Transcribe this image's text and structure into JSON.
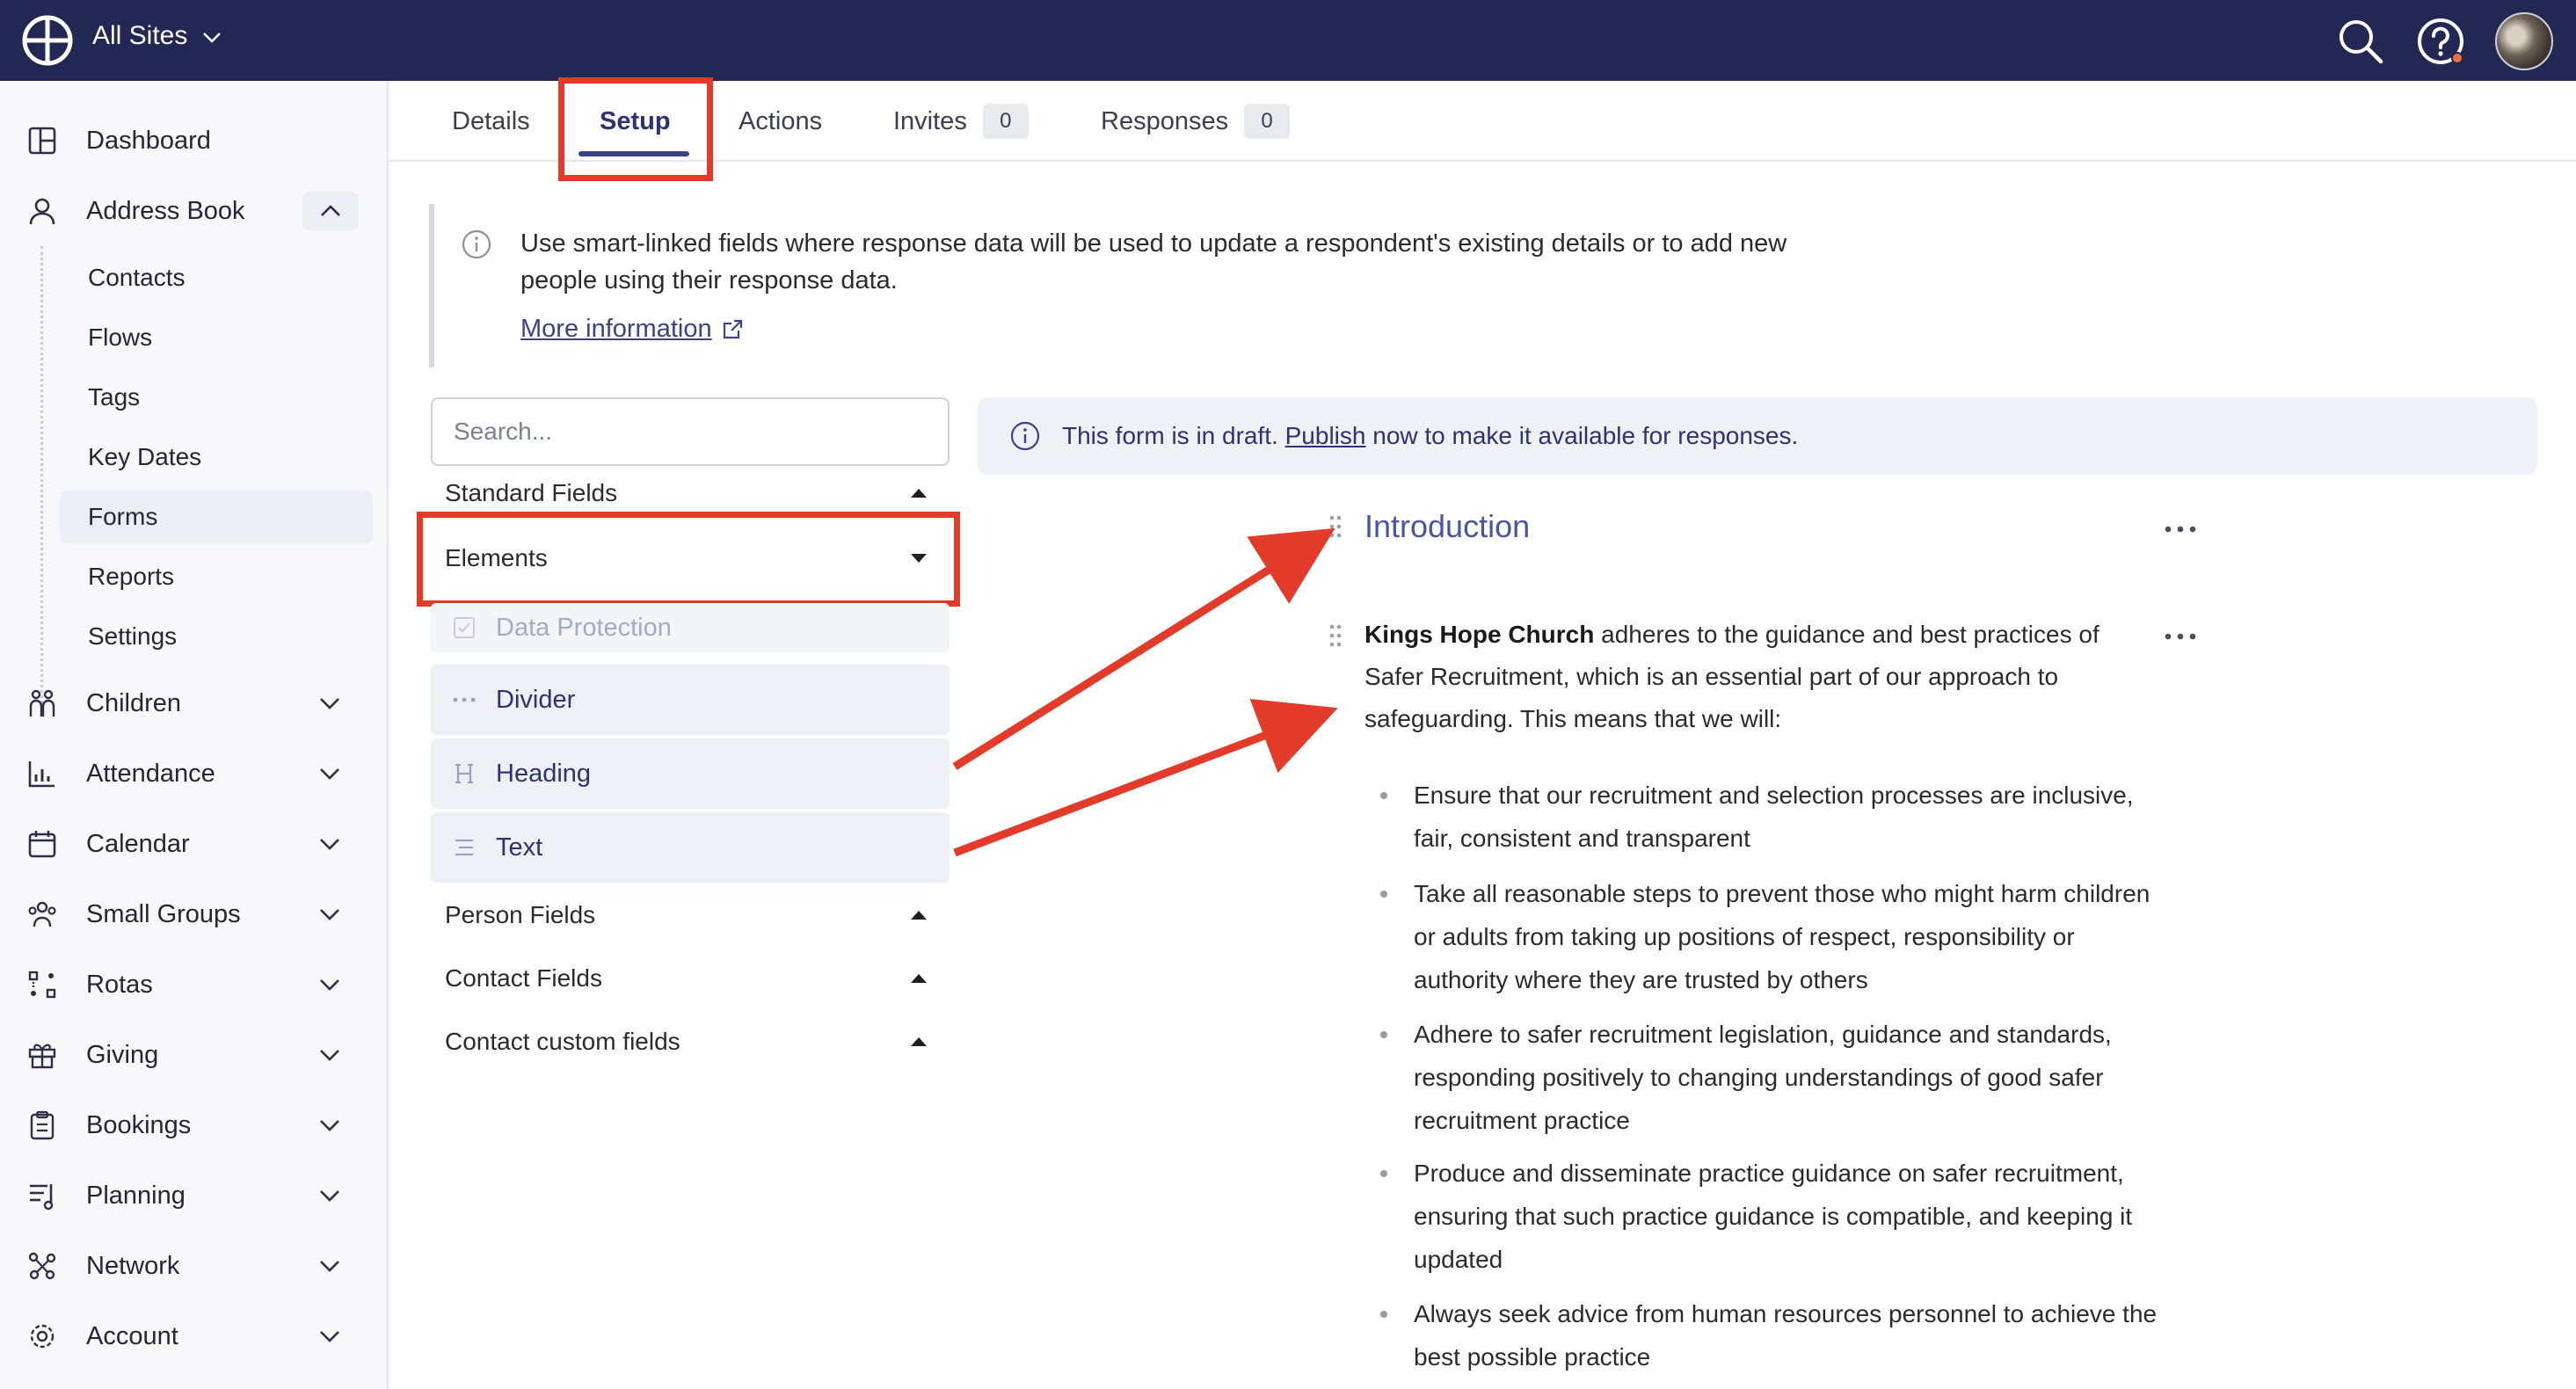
{
  "topbar": {
    "site_selector": "All Sites",
    "search_icon": "search-icon",
    "help_icon": "help-icon"
  },
  "sidebar": {
    "items": [
      {
        "label": "Dashboard",
        "icon": "dashboard-icon"
      },
      {
        "label": "Address Book",
        "icon": "person-icon"
      },
      {
        "label": "Children",
        "icon": "children-icon"
      },
      {
        "label": "Attendance",
        "icon": "chart-icon"
      },
      {
        "label": "Calendar",
        "icon": "calendar-icon"
      },
      {
        "label": "Small Groups",
        "icon": "groups-icon"
      },
      {
        "label": "Rotas",
        "icon": "rotas-icon"
      },
      {
        "label": "Giving",
        "icon": "gift-icon"
      },
      {
        "label": "Bookings",
        "icon": "clipboard-icon"
      },
      {
        "label": "Planning",
        "icon": "planning-icon"
      },
      {
        "label": "Network",
        "icon": "network-icon"
      },
      {
        "label": "Account",
        "icon": "gear-icon"
      }
    ],
    "address_book_sub": [
      "Contacts",
      "Flows",
      "Tags",
      "Key Dates",
      "Forms",
      "Reports",
      "Settings"
    ],
    "active_sub": "Forms"
  },
  "tabs": {
    "details": "Details",
    "setup": "Setup",
    "actions": "Actions",
    "invites": "Invites",
    "invites_count": "0",
    "responses": "Responses",
    "responses_count": "0",
    "active": "Setup"
  },
  "note": {
    "text": "Use smart-linked fields where response data will be used to update a respondent's existing details or to add new people using their response data.",
    "more_link": "More information"
  },
  "palette": {
    "search_placeholder": "Search...",
    "standard_fields": "Standard Fields",
    "elements": "Elements",
    "element_items": [
      "Data Protection",
      "Divider",
      "Heading",
      "Text"
    ],
    "person_fields": "Person Fields",
    "contact_fields": "Contact Fields",
    "contact_custom_fields": "Contact custom fields"
  },
  "preview": {
    "banner_before": "This form is in draft.",
    "banner_link": "Publish",
    "banner_after": "now to make it available for responses.",
    "intro_title": "Introduction",
    "org_name": "Kings Hope Church",
    "body": "adheres to the guidance and best practices of Safer Recruitment, which is an essential part of our approach to safeguarding. This means that we will:",
    "bullets": [
      "Ensure that our recruitment and selection processes are inclusive, fair, consistent and transparent",
      "Take all reasonable steps to prevent those who might harm children or adults from taking up positions of respect, responsibility or authority where they are trusted by others",
      "Adhere to safer recruitment legislation, guidance and standards, responding positively to changing understandings of good safer recruitment practice",
      "Produce and disseminate practice guidance on safer recruitment, ensuring that such practice guidance is compatible, and keeping it updated",
      "Always seek advice from human resources personnel to achieve the best possible practice"
    ]
  },
  "annotation_color": "#e23b2a",
  "brand_color": "#222753"
}
